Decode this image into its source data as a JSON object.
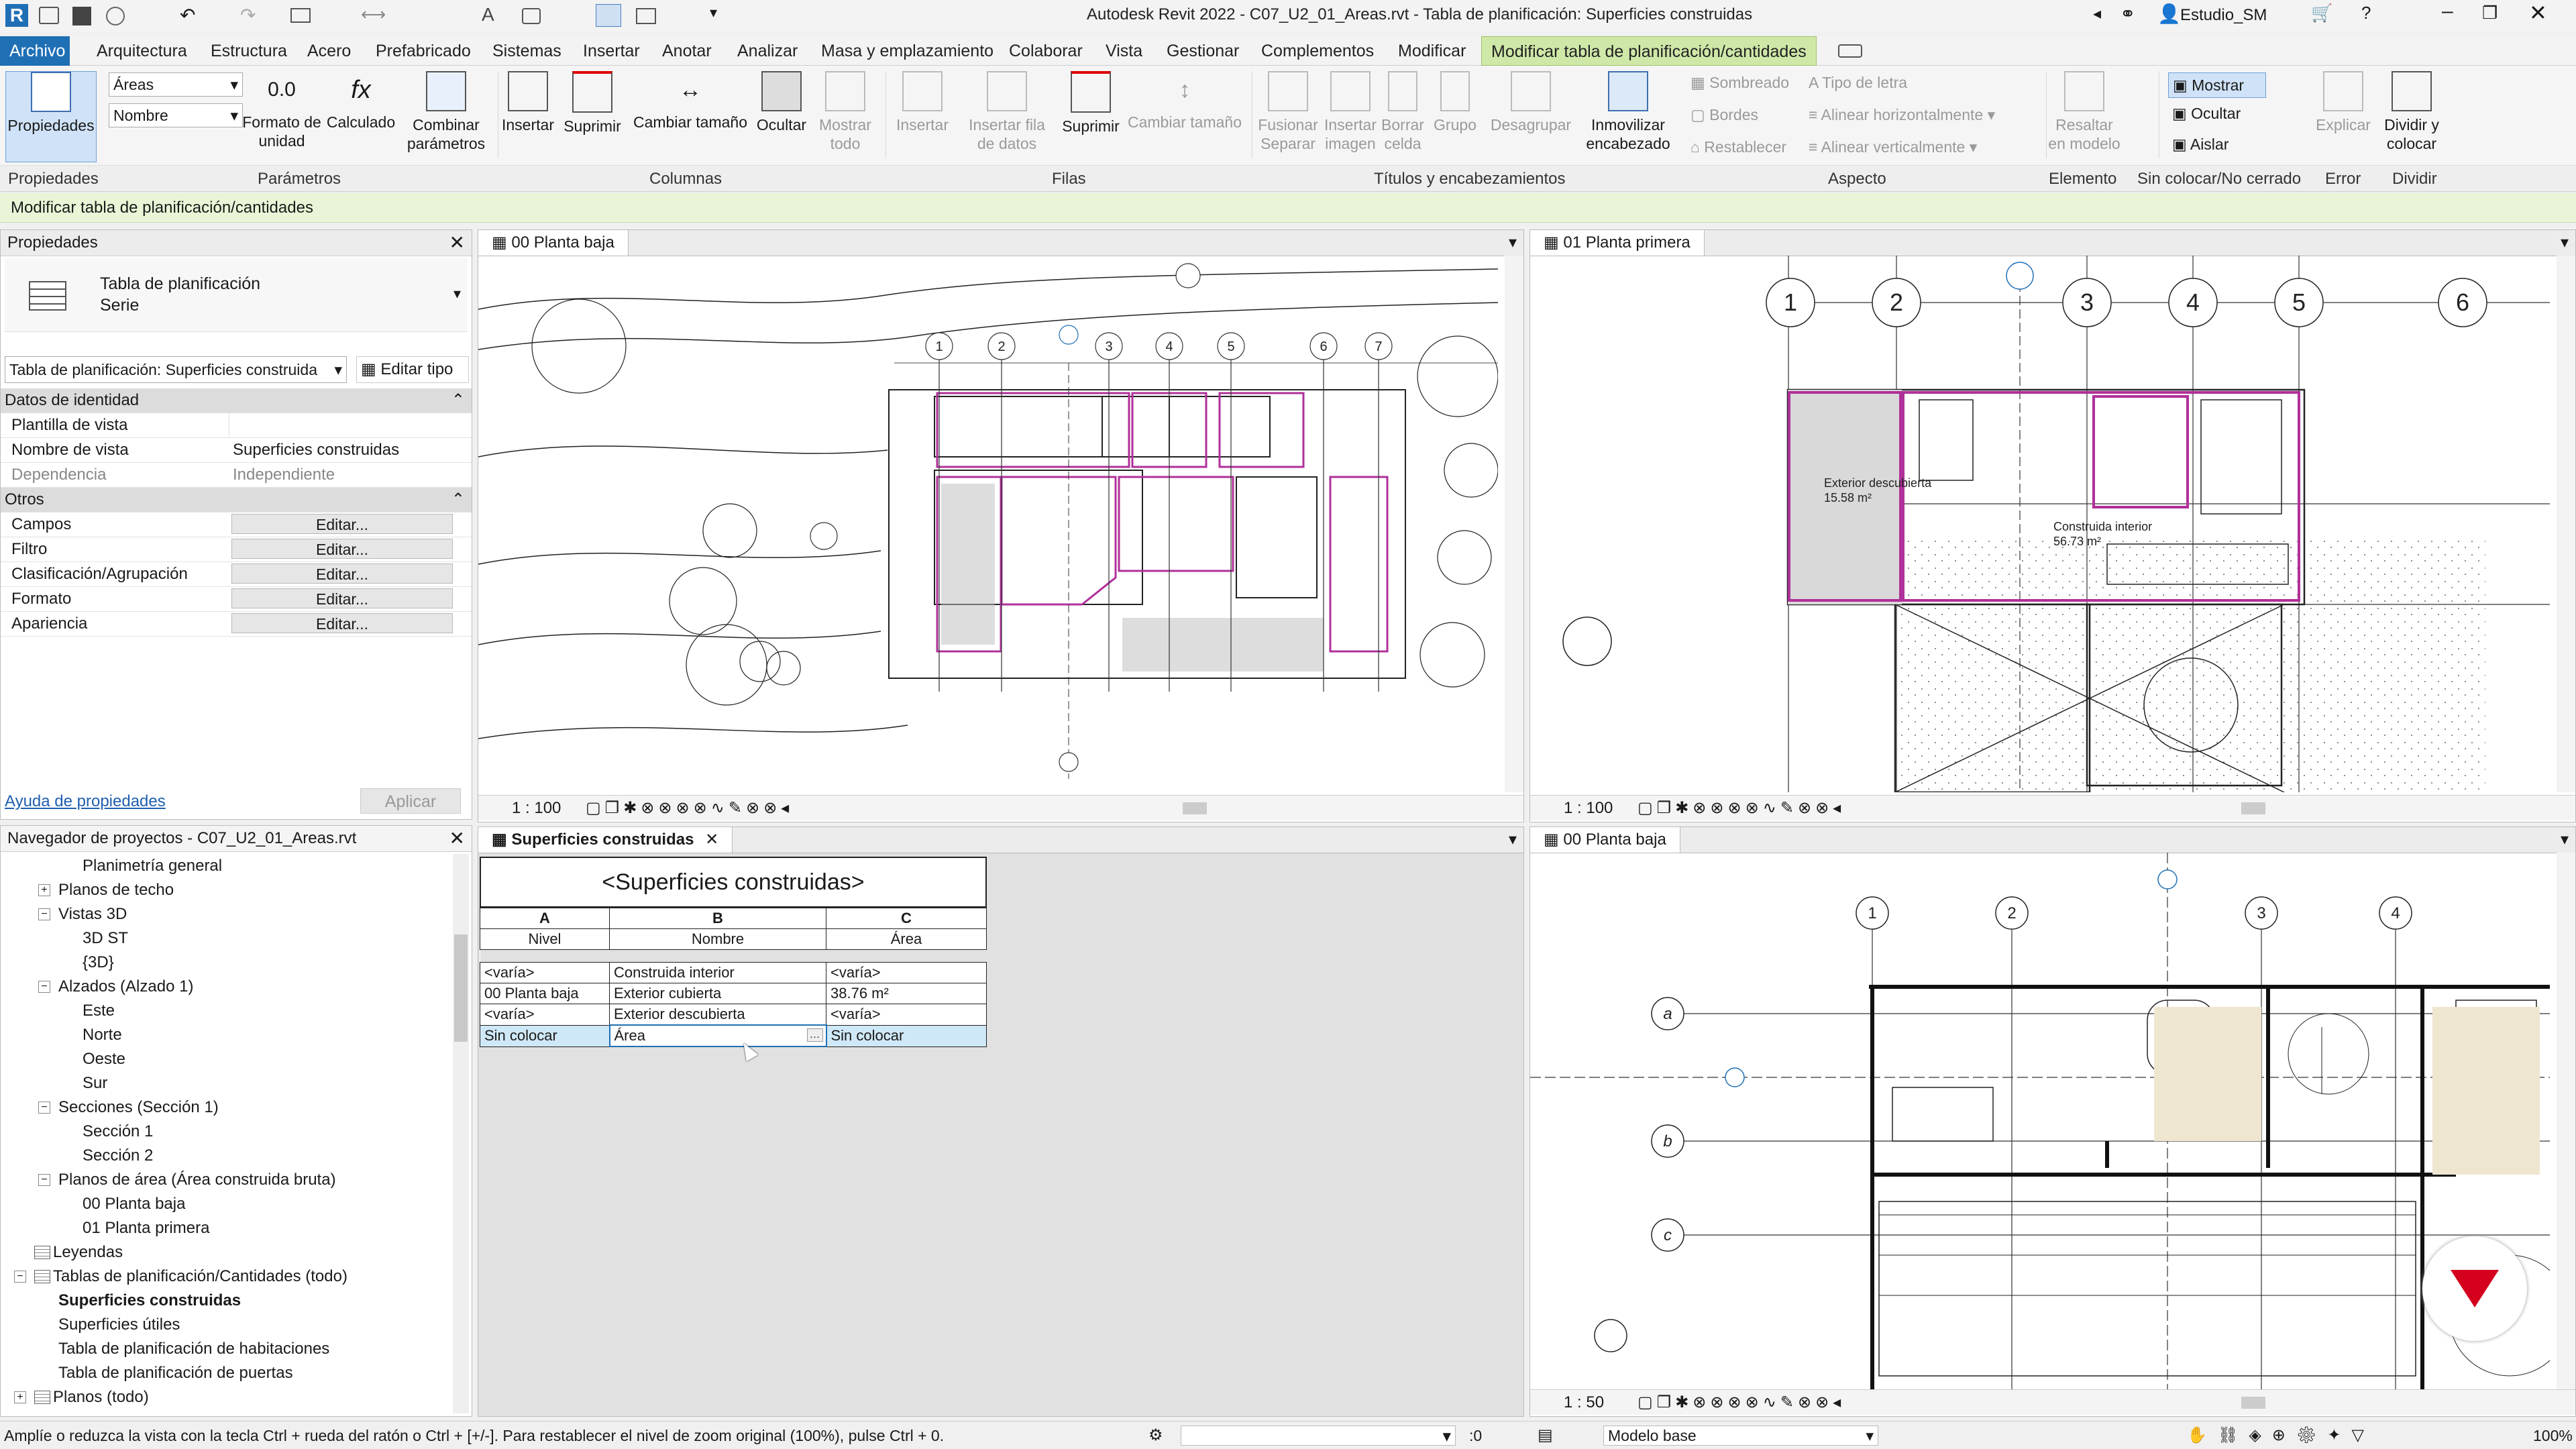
{
  "window": {
    "title": "Autodesk Revit 2022 - C07_U2_01_Areas.rvt - Tabla de planificación: Superficies construidas",
    "user": "Estudio_SM"
  },
  "ribbon_tabs": [
    "Archivo",
    "Arquitectura",
    "Estructura",
    "Acero",
    "Prefabricado",
    "Sistemas",
    "Insertar",
    "Anotar",
    "Analizar",
    "Masa y emplazamiento",
    "Colaborar",
    "Vista",
    "Gestionar",
    "Complementos",
    "Modificar",
    "Modificar tabla de planificación/cantidades"
  ],
  "ribbon": {
    "propiedades": "Propiedades",
    "field_select": "Áreas",
    "name_select": "Nombre",
    "formato_unidad": "Formato de unidad",
    "calculado": "Calculado",
    "combinar_parametros": "Combinar parámetros",
    "insertar": "Insertar",
    "suprimir": "Suprimir",
    "cambiar_tamano": "Cambiar tamaño",
    "ocultar": "Ocultar",
    "mostrar_todo": "Mostrar todo",
    "insertar_filas": "Insertar",
    "insertar_fila_datos": "Insertar fila de datos",
    "suprimir_filas": "Suprimir",
    "cambiar_tamano_filas": "Cambiar tamaño",
    "fusionar_separar": "Fusionar Separar",
    "insertar_imagen": "Insertar imagen",
    "borrar_celda": "Borrar celda",
    "grupo": "Grupo",
    "desagrupar": "Desagrupar",
    "inmovilizar": "Inmovilizar encabezado",
    "sombreado": "Sombreado",
    "bordes": "Bordes",
    "restablecer": "Restablecer",
    "tipo_letra": "Tipo de letra",
    "alinear_h": "Alinear horizontalmente",
    "alinear_v": "Alinear verticalmente",
    "resaltar": "Resaltar en modelo",
    "mostrar": "Mostrar",
    "ocultar_ap": "Ocultar",
    "aislar": "Aislar",
    "explicar": "Explicar",
    "dividir": "Dividir y colocar"
  },
  "panel_labels": [
    "Propiedades",
    "Parámetros",
    "Columnas",
    "Filas",
    "Títulos y encabezamientos",
    "Aspecto",
    "Elemento",
    "Sin colocar/No cerrado",
    "Error",
    "Dividir"
  ],
  "context_label": "Modificar tabla de planificación/cantidades",
  "properties": {
    "title": "Propiedades",
    "type_name": "Tabla de planificación",
    "type_sub": "Serie",
    "selector": "Tabla de planificación: Superficies construida",
    "edit_type": "Editar tipo",
    "group_identity": "Datos de identidad",
    "rows_identity": [
      {
        "label": "Plantilla de vista",
        "value": ""
      },
      {
        "label": "Nombre de vista",
        "value": "Superficies construidas"
      },
      {
        "label": "Dependencia",
        "value": "Independiente"
      }
    ],
    "group_others": "Otros",
    "rows_others": [
      {
        "label": "Campos",
        "value": "Editar..."
      },
      {
        "label": "Filtro",
        "value": "Editar..."
      },
      {
        "label": "Clasificación/Agrupación",
        "value": "Editar..."
      },
      {
        "label": "Formato",
        "value": "Editar..."
      },
      {
        "label": "Apariencia",
        "value": "Editar..."
      }
    ],
    "help_link": "Ayuda de propiedades",
    "apply": "Aplicar"
  },
  "browser": {
    "title": "Navegador de proyectos - C07_U2_01_Areas.rvt",
    "items": [
      {
        "label": "Planimetría general",
        "indent": 3,
        "bold": false
      },
      {
        "label": "Planos de techo",
        "indent": 2,
        "bold": false,
        "toggle": "+"
      },
      {
        "label": "Vistas 3D",
        "indent": 2,
        "bold": false,
        "toggle": "−"
      },
      {
        "label": "3D ST",
        "indent": 3,
        "bold": false
      },
      {
        "label": "{3D}",
        "indent": 3,
        "bold": false
      },
      {
        "label": "Alzados (Alzado 1)",
        "indent": 2,
        "bold": false,
        "toggle": "−"
      },
      {
        "label": "Este",
        "indent": 3,
        "bold": false
      },
      {
        "label": "Norte",
        "indent": 3,
        "bold": false
      },
      {
        "label": "Oeste",
        "indent": 3,
        "bold": false
      },
      {
        "label": "Sur",
        "indent": 3,
        "bold": false
      },
      {
        "label": "Secciones (Sección 1)",
        "indent": 2,
        "bold": false,
        "toggle": "−"
      },
      {
        "label": "Sección 1",
        "indent": 3,
        "bold": false
      },
      {
        "label": "Sección 2",
        "indent": 3,
        "bold": false
      },
      {
        "label": "Planos de área (Área construida bruta)",
        "indent": 2,
        "bold": false,
        "toggle": "−"
      },
      {
        "label": "00 Planta baja",
        "indent": 3,
        "bold": false
      },
      {
        "label": "01 Planta primera",
        "indent": 3,
        "bold": false
      },
      {
        "label": "Leyendas",
        "indent": 1,
        "bold": false
      },
      {
        "label": "Tablas de planificación/Cantidades (todo)",
        "indent": 1,
        "bold": false,
        "toggle": "−"
      },
      {
        "label": "Superficies construidas",
        "indent": 2,
        "bold": true
      },
      {
        "label": "Superficies útiles",
        "indent": 2,
        "bold": false
      },
      {
        "label": "Tabla de planificación de habitaciones",
        "indent": 2,
        "bold": false
      },
      {
        "label": "Tabla de planificación de puertas",
        "indent": 2,
        "bold": false
      },
      {
        "label": "Planos (todo)",
        "indent": 1,
        "bold": false,
        "toggle": "+"
      }
    ]
  },
  "views": {
    "tl_tab": "00 Planta baja",
    "tl_scale": "1 : 100",
    "tr_tab": "01 Planta primera",
    "tr_scale": "1 : 100",
    "br_tab": "00 Planta baja",
    "br_scale": "1 : 50",
    "sched_tab": "Superficies construidas",
    "tr_labels": [
      "Exterior descubierta",
      "Construida interior"
    ],
    "tr_areas": [
      "15.58 m²",
      "56.73 m²"
    ],
    "tl_grids": [
      "1",
      "2",
      "3",
      "4",
      "5",
      "6",
      "7"
    ],
    "tr_grids": [
      "1",
      "2",
      "3",
      "4",
      "5",
      "6"
    ],
    "br_grids": [
      "1",
      "2",
      "3",
      "4"
    ],
    "br_rows": [
      "a",
      "b",
      "c"
    ]
  },
  "schedule": {
    "title": "<Superficies construidas>",
    "col_letters": [
      "A",
      "B",
      "C"
    ],
    "col_names": [
      "Nivel",
      "Nombre",
      "Área"
    ],
    "rows": [
      [
        "<varía>",
        "Construida interior",
        "<varía>"
      ],
      [
        "00 Planta baja",
        "Exterior cubierta",
        "38.76 m²"
      ],
      [
        "<varía>",
        "Exterior descubierta",
        "<varía>"
      ],
      [
        "Sin colocar",
        "Área",
        "Sin colocar"
      ]
    ]
  },
  "statusbar": {
    "hint": "Amplíe o reduzca la vista con la tecla Ctrl + rueda del ratón o Ctrl + [+/-]. Para restablecer el nivel de zoom original (100%), pulse Ctrl + 0.",
    "selection": ":0",
    "model": "Modelo base",
    "zoom": "100%"
  },
  "colors": {
    "accent_blue": "#1f6fb5",
    "area_magenta": "#b0309a",
    "context_green": "#e9f5d6",
    "brand_red": "#d4001e"
  }
}
